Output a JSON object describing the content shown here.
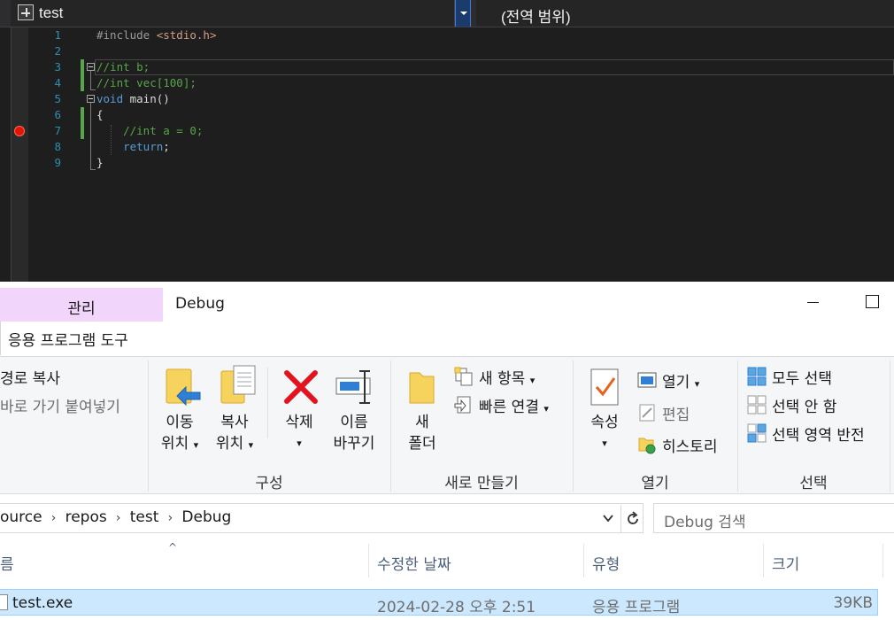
{
  "editor": {
    "scope_left": "test",
    "scope_right": "(전역 범위)",
    "lines": [
      {
        "number": "1",
        "parts": [
          {
            "t": "#include ",
            "c": "pp"
          },
          {
            "t": "<stdio.h>",
            "c": "inc"
          }
        ]
      },
      {
        "number": "2",
        "parts": []
      },
      {
        "number": "3",
        "parts": [
          {
            "t": "//int b;",
            "c": "cm"
          }
        ]
      },
      {
        "number": "4",
        "parts": [
          {
            "t": "//int vec[100];",
            "c": "cm"
          }
        ]
      },
      {
        "number": "5",
        "parts": [
          {
            "t": "void",
            "c": "kw"
          },
          {
            "t": " main()",
            "c": ""
          }
        ]
      },
      {
        "number": "6",
        "parts": [
          {
            "t": "{",
            "c": ""
          }
        ]
      },
      {
        "number": "7",
        "parts": [
          {
            "t": "    //int a = 0;",
            "c": "cm"
          }
        ]
      },
      {
        "number": "8",
        "parts": [
          {
            "t": "    ",
            "c": ""
          },
          {
            "t": "return",
            "c": "kw"
          },
          {
            "t": ";",
            "c": ""
          }
        ]
      },
      {
        "number": "9",
        "parts": [
          {
            "t": "}",
            "c": ""
          }
        ]
      }
    ],
    "colors": {
      "keyword": "#569cd6",
      "comment": "#57a64a",
      "include": "#d69d85",
      "line_number": "#2b91af",
      "breakpoint": "#e51400"
    }
  },
  "explorer": {
    "tab_manage": "관리",
    "tab_tools": "응용 프로그램 도구",
    "window_title": "Debug",
    "ribbon": {
      "copy_path": "경로 복사",
      "paste_shortcut": "바로 가기 붙여넣기",
      "move_to": [
        "이동",
        "위치"
      ],
      "copy_to": [
        "복사",
        "위치"
      ],
      "delete": "삭제",
      "rename": [
        "이름",
        "바꾸기"
      ],
      "new_folder": [
        "새",
        "폴더"
      ],
      "new_item": "새 항목",
      "easy_access": "빠른 연결",
      "properties": "속성",
      "open": "열기",
      "edit": "편집",
      "history": "히스토리",
      "select_all": "모두 선택",
      "select_none": "선택 안 함",
      "invert_selection": "선택 영역 반전",
      "groups": {
        "organize": "구성",
        "new": "새로 만들기",
        "open": "열기",
        "select": "선택"
      }
    },
    "breadcrumb": [
      "ource",
      "repos",
      "test",
      "Debug"
    ],
    "search_placeholder": "Debug 검색",
    "columns": {
      "name": "름",
      "date": "수정한 날짜",
      "type": "유형",
      "size": "크기"
    },
    "files": [
      {
        "name": "test.exe",
        "date": "2024-02-28 오후 2:51",
        "type": "응용 프로그램",
        "size": "39KB"
      }
    ],
    "colors": {
      "selected_row": "#cce8ff",
      "manage_tab": "#f2d5fb"
    }
  }
}
